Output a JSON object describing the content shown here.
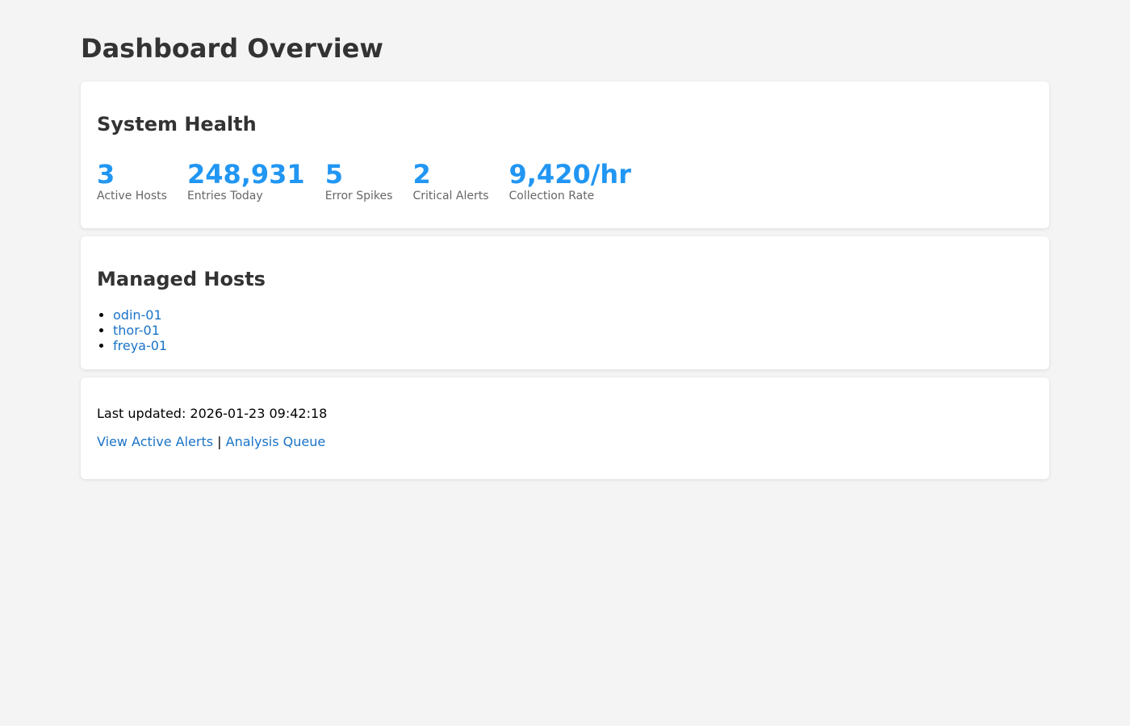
{
  "page": {
    "title": "Dashboard Overview"
  },
  "health": {
    "title": "System Health",
    "stats": [
      {
        "value": "3",
        "label": "Active Hosts"
      },
      {
        "value": "248,931",
        "label": "Entries Today"
      },
      {
        "value": "5",
        "label": "Error Spikes"
      },
      {
        "value": "2",
        "label": "Critical Alerts"
      },
      {
        "value": "9,420/hr",
        "label": "Collection Rate"
      }
    ]
  },
  "hosts": {
    "title": "Managed Hosts",
    "items": [
      "odin-01",
      "thor-01",
      "freya-01"
    ]
  },
  "footer": {
    "updated": "Last updated: 2026-01-23 09:42:18",
    "link_alerts": "View Active Alerts",
    "separator": "|",
    "link_queue": "Analysis Queue"
  },
  "colors": {
    "accent": "#2196f3",
    "link": "#1a73c7",
    "background": "#f4f4f4"
  }
}
